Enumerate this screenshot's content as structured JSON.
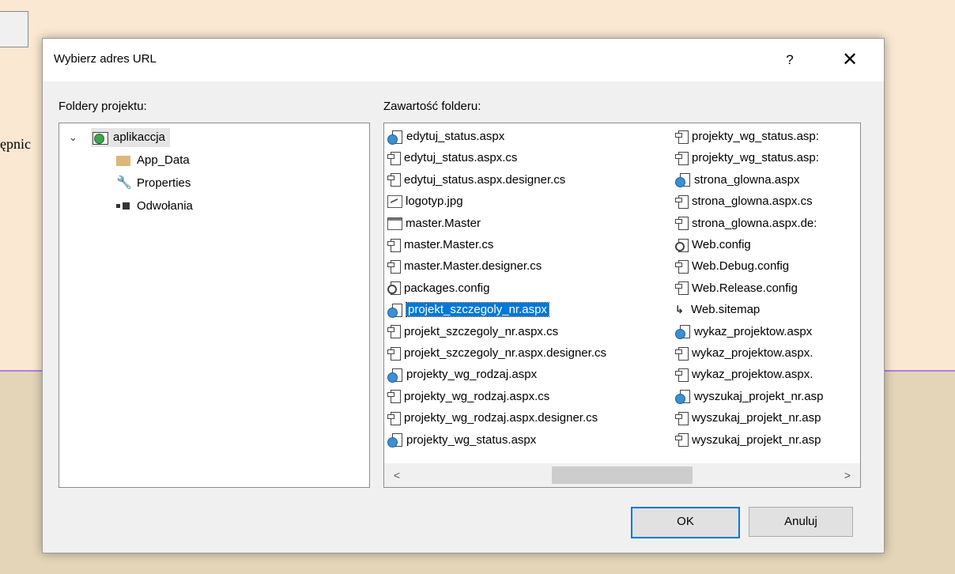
{
  "background": {
    "side_text": "ępnic"
  },
  "dialog": {
    "title": "Wybierz adres URL",
    "help_label": "?",
    "close_label": "✕",
    "folders_label": "Foldery projektu:",
    "contents_label": "Zawartość folderu:",
    "ok_label": "OK",
    "cancel_label": "Anuluj"
  },
  "tree": {
    "root": {
      "label": "aplikaccja",
      "icon": "web-project-icon",
      "expanded": true
    },
    "children": [
      {
        "label": "App_Data",
        "icon": "folder-icon"
      },
      {
        "label": "Properties",
        "icon": "wrench-icon"
      },
      {
        "label": "Odwołania",
        "icon": "references-icon"
      }
    ]
  },
  "files": {
    "column1": [
      {
        "name": "edytuj_status.aspx",
        "icon": "aspx-file-icon"
      },
      {
        "name": "edytuj_status.aspx.cs",
        "icon": "cs-file-icon"
      },
      {
        "name": "edytuj_status.aspx.designer.cs",
        "icon": "cs-file-icon"
      },
      {
        "name": "logotyp.jpg",
        "icon": "image-file-icon"
      },
      {
        "name": "master.Master",
        "icon": "master-file-icon"
      },
      {
        "name": "master.Master.cs",
        "icon": "cs-file-icon"
      },
      {
        "name": "master.Master.designer.cs",
        "icon": "cs-file-icon"
      },
      {
        "name": "packages.config",
        "icon": "config-file-icon"
      },
      {
        "name": "projekt_szczegoly_nr.aspx",
        "icon": "aspx-file-icon",
        "selected": true
      },
      {
        "name": "projekt_szczegoly_nr.aspx.cs",
        "icon": "cs-file-icon"
      },
      {
        "name": "projekt_szczegoly_nr.aspx.designer.cs",
        "icon": "cs-file-icon"
      },
      {
        "name": "projekty_wg_rodzaj.aspx",
        "icon": "aspx-file-icon"
      },
      {
        "name": "projekty_wg_rodzaj.aspx.cs",
        "icon": "cs-file-icon"
      },
      {
        "name": "projekty_wg_rodzaj.aspx.designer.cs",
        "icon": "cs-file-icon"
      },
      {
        "name": "projekty_wg_status.aspx",
        "icon": "aspx-file-icon"
      }
    ],
    "column2": [
      {
        "name": "projekty_wg_status.asp:",
        "icon": "cs-file-icon"
      },
      {
        "name": "projekty_wg_status.asp:",
        "icon": "cs-file-icon"
      },
      {
        "name": "strona_glowna.aspx",
        "icon": "aspx-file-icon"
      },
      {
        "name": "strona_glowna.aspx.cs",
        "icon": "cs-file-icon"
      },
      {
        "name": "strona_glowna.aspx.de:",
        "icon": "cs-file-icon"
      },
      {
        "name": "Web.config",
        "icon": "config-file-icon"
      },
      {
        "name": "Web.Debug.config",
        "icon": "cs-file-icon"
      },
      {
        "name": "Web.Release.config",
        "icon": "cs-file-icon"
      },
      {
        "name": "Web.sitemap",
        "icon": "sitemap-file-icon"
      },
      {
        "name": "wykaz_projektow.aspx",
        "icon": "aspx-file-icon"
      },
      {
        "name": "wykaz_projektow.aspx.",
        "icon": "cs-file-icon"
      },
      {
        "name": "wykaz_projektow.aspx.",
        "icon": "cs-file-icon"
      },
      {
        "name": "wyszukaj_projekt_nr.asp",
        "icon": "aspx-file-icon"
      },
      {
        "name": "wyszukaj_projekt_nr.asp",
        "icon": "cs-file-icon"
      },
      {
        "name": "wyszukaj_projekt_nr.asp",
        "icon": "cs-file-icon"
      }
    ],
    "scroll_left": "<",
    "scroll_right": ">"
  },
  "colors": {
    "accent": "#0078d7",
    "page_bg_top": "#fbe8d2",
    "page_bg_bottom": "#e4d5b8",
    "divider": "#b57de0"
  }
}
